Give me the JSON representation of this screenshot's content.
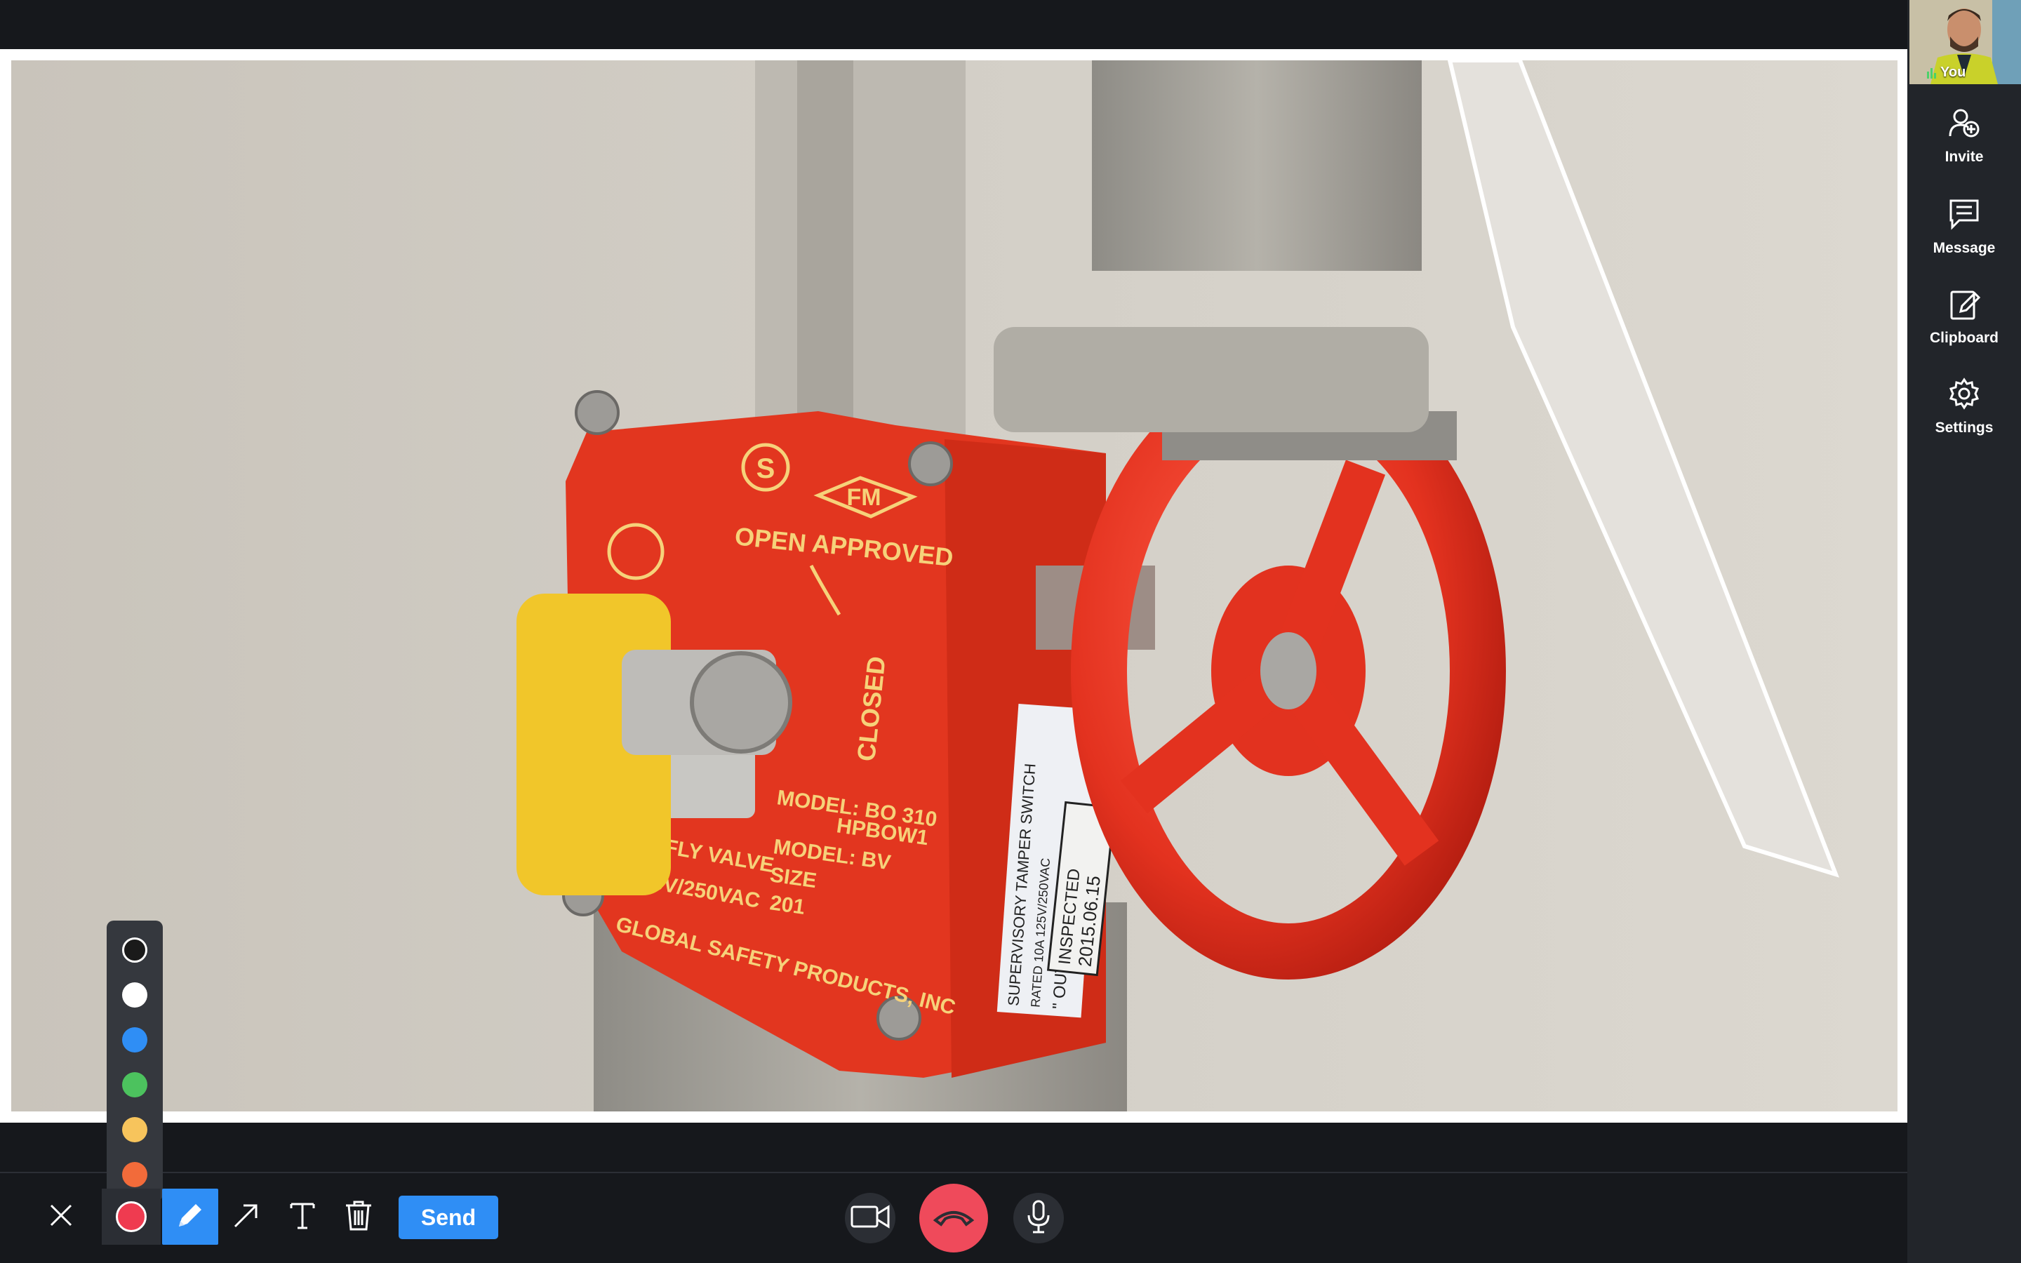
{
  "self_view": {
    "label": "You"
  },
  "sidebar": {
    "items": [
      {
        "id": "invite",
        "label": "Invite",
        "icon": "add-user-icon"
      },
      {
        "id": "message",
        "label": "Message",
        "icon": "chat-icon"
      },
      {
        "id": "clipboard",
        "label": "Clipboard",
        "icon": "clipboard-edit-icon"
      },
      {
        "id": "settings",
        "label": "Settings",
        "icon": "gear-icon"
      }
    ]
  },
  "photo": {
    "label_texts": {
      "open": "OPEN",
      "approved": "APPROVED",
      "closed": "CLOSED",
      "fm": "FM",
      "s": "S",
      "model1": "MODEL: BO 310",
      "model1b": "HPBOW1",
      "model2": "MODEL: BV",
      "size": "SIZE",
      "size_val": "201",
      "valve": "FLY VALVE",
      "rating": "A 125V/250VAC",
      "maker": "GLOBAL SAFETY PRODUCTS, INC",
      "sticker1": "SUPERVISORY TAMPER SWITCH",
      "sticker2": "RATED 10A 125V/250VAC",
      "sticker3": "\" OUTDOOR USE \"",
      "inspected": "INSPECTED",
      "inspected_date": "2015.06.15"
    }
  },
  "palette": {
    "colors": [
      {
        "name": "black",
        "hex": "#1a1a1a"
      },
      {
        "name": "white",
        "hex": "#ffffff"
      },
      {
        "name": "blue",
        "hex": "#2f8ef5"
      },
      {
        "name": "green",
        "hex": "#4cc25e"
      },
      {
        "name": "yellow",
        "hex": "#f7c45c"
      },
      {
        "name": "orange",
        "hex": "#f26b3a"
      }
    ],
    "selected": {
      "name": "red",
      "hex": "#ef3b50"
    }
  },
  "toolbar": {
    "close_icon": "close-icon",
    "pen_icon": "pen-icon",
    "arrow_icon": "arrow-icon",
    "text_icon": "text-icon",
    "trash_icon": "trash-icon",
    "send_label": "Send"
  },
  "call_controls": {
    "camera_icon": "video-camera-icon",
    "end_call_icon": "end-call-icon",
    "mic_icon": "microphone-icon"
  },
  "colors": {
    "accent": "#2f8ef5",
    "end_call": "#ef4a5b",
    "background": "#16181c",
    "sidebar": "#22252a"
  }
}
